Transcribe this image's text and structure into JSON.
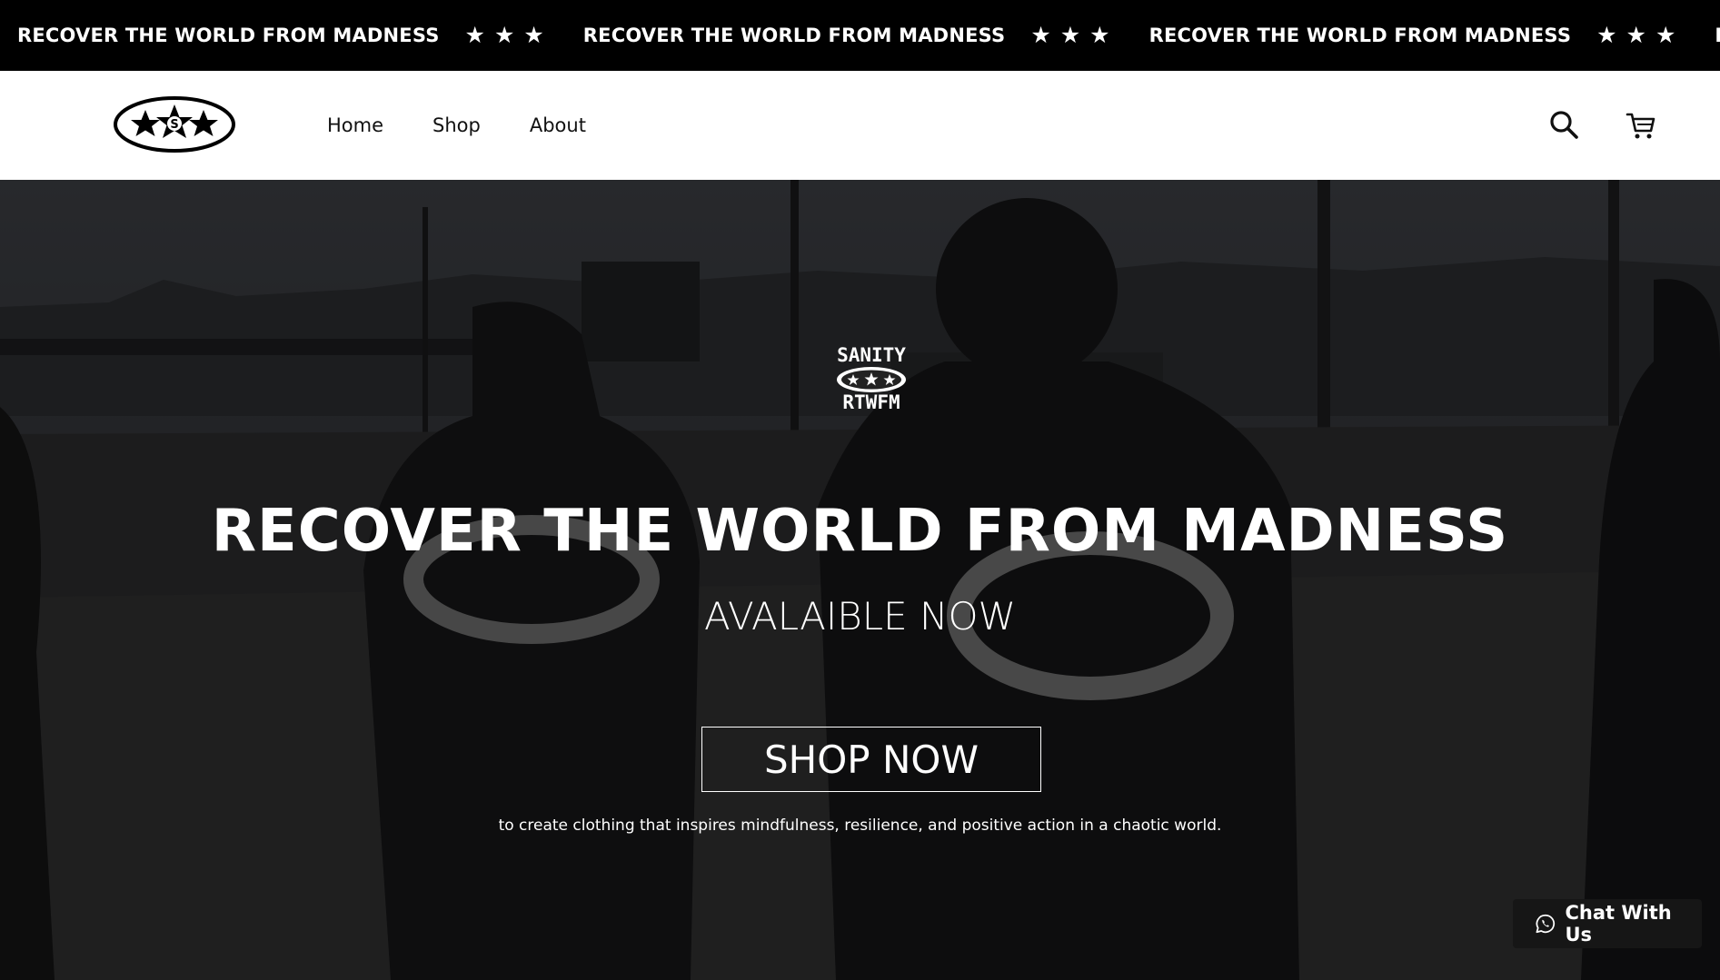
{
  "announcement": {
    "text": "RECOVER THE WORLD FROM MADNESS",
    "separator": "★★★",
    "repeat": 4
  },
  "header": {
    "logo": "sanity-star-logo",
    "logo_letter": "S",
    "nav": [
      {
        "label": "Home"
      },
      {
        "label": "Shop"
      },
      {
        "label": "About"
      }
    ],
    "icons": {
      "search": "search-icon",
      "cart": "cart-icon"
    }
  },
  "hero": {
    "emblem_top": "SANITY",
    "emblem_bottom": "RTWFM",
    "title": "RECOVER THE WORLD FROM MADNESS",
    "subtitle": "AVALAIBLE NOW",
    "cta": "SHOP NOW",
    "tagline": "to create clothing that inspires mindfulness, resilience, and positive action in a chaotic world."
  },
  "chat": {
    "label": "Chat With Us",
    "icon": "whatsapp-icon"
  },
  "colors": {
    "bar": "#000000",
    "header_bg": "#ffffff",
    "text_light": "#ffffff",
    "chat_bg": "#161616"
  }
}
